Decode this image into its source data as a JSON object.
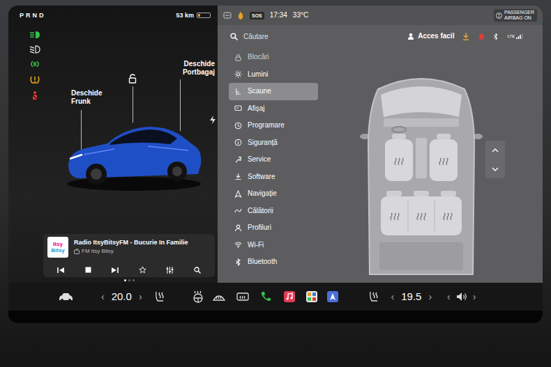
{
  "status": {
    "gear": "PRND",
    "range": "53 km",
    "battery_level": 0.2,
    "sos": "SOS",
    "time": "17:34",
    "temperature": "33°C",
    "airbag": "PASSENGER AIRBAG ON",
    "network": "LTE"
  },
  "indicators": [
    {
      "kind": "auto-high-beam",
      "color": "#35c24a"
    },
    {
      "kind": "low-beam",
      "color": "#d0d0d0"
    },
    {
      "kind": "parking-lights",
      "color": "#35c24a"
    },
    {
      "kind": "tire-pressure",
      "color": "#e7a21f"
    },
    {
      "kind": "seatbelt",
      "color": "#e23b36"
    }
  ],
  "car": {
    "frunk": "Deschide Frunk",
    "trunk": "Deschide Portbagaj",
    "locked": false,
    "charging": true
  },
  "media": {
    "logo": [
      "Itsy",
      "Bitsy"
    ],
    "title": "Radio ItsyBitsyFM - Bucurie In Familie",
    "station": "FM Itsy Bitsy",
    "pages": [
      {
        "selected": true
      },
      {
        "selected": false
      },
      {
        "selected": false
      }
    ]
  },
  "settings": {
    "search_placeholder": "Căutare",
    "profile": "Acces facil",
    "menu": [
      {
        "label": "Blocări",
        "selected": false
      },
      {
        "label": "Lumini",
        "selected": false
      },
      {
        "label": "Scaune",
        "selected": true
      },
      {
        "label": "Afișaj",
        "selected": false
      },
      {
        "label": "Programare",
        "selected": false
      },
      {
        "label": "Siguranță",
        "selected": false
      },
      {
        "label": "Service",
        "selected": false
      },
      {
        "label": "Software",
        "selected": false
      },
      {
        "label": "Navigație",
        "selected": false
      },
      {
        "label": "Călătorii",
        "selected": false
      },
      {
        "label": "Profiluri",
        "selected": false
      },
      {
        "label": "Wi-Fi",
        "selected": false
      },
      {
        "label": "Bluetooth",
        "selected": false
      }
    ]
  },
  "climate": {
    "driver_temp": "20.0",
    "passenger_temp": "19.5",
    "decrease": "‹",
    "increase": "›"
  },
  "volume": {
    "decrease": "‹",
    "increase": "›"
  }
}
